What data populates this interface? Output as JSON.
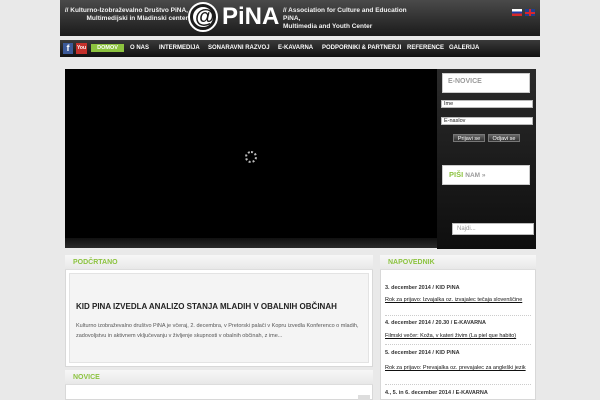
{
  "header": {
    "left_tagline_1": "// Kulturno-Izobraževalno Društvo PiNA,",
    "left_tagline_2": "Multimedijski in Mladinski center",
    "logo_at": "@",
    "logo_text": "PiNA",
    "right_tagline_1": "// Association for Culture and Education PiNA,",
    "right_tagline_2": "Multimedia and Youth Center"
  },
  "social": {
    "facebook": "f",
    "youtube": "You"
  },
  "nav": {
    "home": "DOMOV",
    "items": [
      "O NAS",
      "INTERMEDIJA",
      "SONARAVNI RAZVOJ",
      "E-KAVARNA",
      "PODPORNIKI & PARTNERJI",
      "REFERENCE",
      "GALERIJA"
    ]
  },
  "newsletter": {
    "title": "E-NOVICE",
    "name_value": "Ime",
    "email_value": "E-naslov",
    "subscribe": "Prijavi se",
    "unsubscribe": "Odjavi se"
  },
  "write_us": {
    "label": "PIŠI",
    "rest": "NAM »"
  },
  "search": {
    "placeholder": "Najdi..."
  },
  "podcrtano": {
    "title": "PODČRTANO",
    "article_title": "KID PINA IZVEDLA ANALIZO STANJA MLADIH V OBALNIH OBČINAH",
    "article_text": "Kulturno izobraževalno društvo PiNA je včeraj, 2. decembra, v Pretorski palači v Kopru izvedla Konferenco o mladih, zadovoljstvu in aktivnem vključevanju v življenje skupnosti v obalnih občinah, z ime..."
  },
  "novice": {
    "title": "NOVICE"
  },
  "napovednik": {
    "title": "NAPOVEDNIK",
    "events": [
      {
        "date": "3. december 2014 / KID PiNA",
        "link": "Rok za prijavo: Izvajalka oz. izvajalec tečaja slovenščine"
      },
      {
        "date": "4. december 2014 / 20.30 / E-KAVARNA",
        "link": "Filmski večer: Koža, v kateri živim (La piel que habito)"
      },
      {
        "date": "5. december 2014 / KID PiNA",
        "link": "Rok za prijavo: Prevajalka oz. prevajalec za angleški jezik"
      },
      {
        "date": "4., 5. in 6. december 2014 / E-KAVARNA",
        "link": ""
      }
    ]
  },
  "colors": {
    "accent": "#8cc33f",
    "dark": "#1b1b1b"
  }
}
